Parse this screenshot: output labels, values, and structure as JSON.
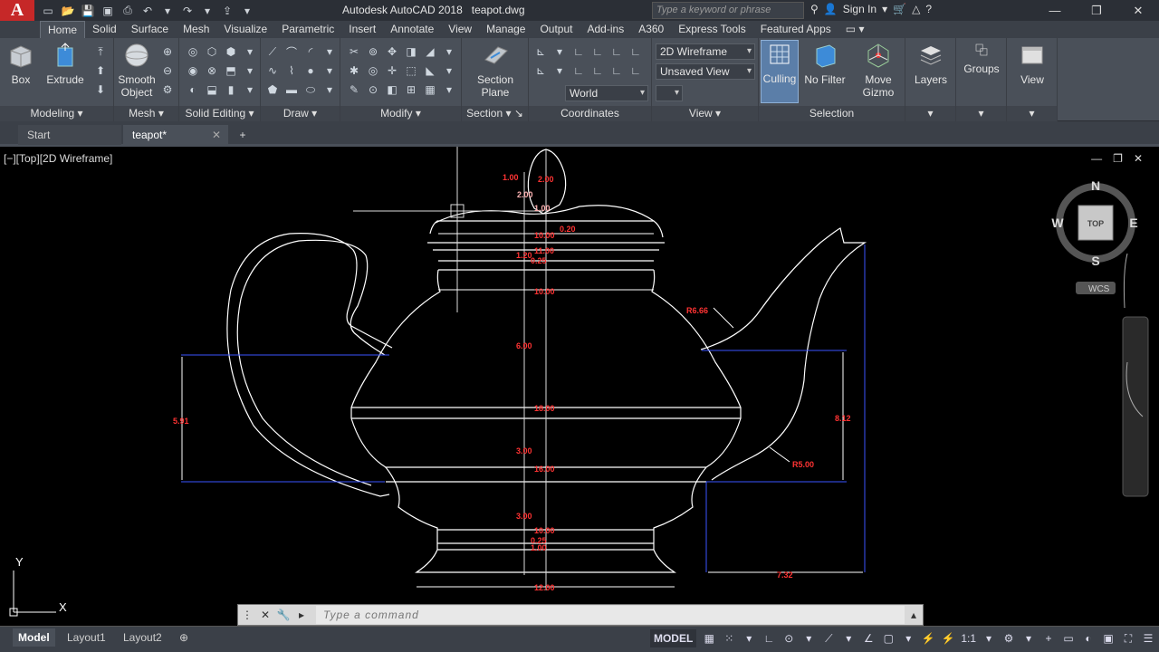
{
  "app": {
    "logo": "A",
    "title": "Autodesk AutoCAD 2018",
    "filename": "teapot.dwg",
    "search_placeholder": "Type a keyword or phrase",
    "signin": "Sign In"
  },
  "ribbon_tabs": [
    "Home",
    "Solid",
    "Surface",
    "Mesh",
    "Visualize",
    "Parametric",
    "Insert",
    "Annotate",
    "View",
    "Manage",
    "Output",
    "Add-ins",
    "A360",
    "Express Tools",
    "Featured Apps"
  ],
  "ribbon": {
    "modeling": {
      "title": "Modeling",
      "box": "Box",
      "extrude": "Extrude"
    },
    "mesh": {
      "title": "Mesh",
      "smooth": "Smooth",
      "object": "Object"
    },
    "solid_editing": {
      "title": "Solid Editing"
    },
    "draw": {
      "title": "Draw"
    },
    "modify": {
      "title": "Modify"
    },
    "section": {
      "title": "Section",
      "plane1": "Section",
      "plane2": "Plane"
    },
    "coordinates": {
      "title": "Coordinates",
      "world": "World"
    },
    "view": {
      "title": "View",
      "visual_style": "2D Wireframe",
      "saved_view": "Unsaved View"
    },
    "selection": {
      "title": "Selection",
      "culling": "Culling",
      "nofilter": "No Filter",
      "gizmo1": "Move",
      "gizmo2": "Gizmo"
    },
    "layers": "Layers",
    "groups": "Groups",
    "view_btn": "View"
  },
  "doc_tabs": {
    "start": "Start",
    "active": "teapot*"
  },
  "viewport": {
    "label": "[−][Top][2D Wireframe]",
    "viewcube": {
      "n": "N",
      "s": "S",
      "e": "E",
      "w": "W",
      "top": "TOP",
      "wcs": "WCS"
    },
    "axis_x": "X",
    "axis_y": "Y"
  },
  "dimensions": {
    "d1": "1.00",
    "d2": "2.00",
    "d3": "2.00",
    "d4": "1.00",
    "d5": "0.20",
    "d6": "10.00",
    "d7": "11.00",
    "d8": "1.20",
    "d9": "0.25",
    "d10": "10.00",
    "d11": "6.00",
    "d12": "18.00",
    "d13": "3.00",
    "d14": "16.00",
    "d15": "3.00",
    "d16": "10.00",
    "d17": "0.25",
    "d18": "1.00",
    "d19": "12.00",
    "d20": "5.91",
    "d21": "8.12",
    "d22": "7.32",
    "r1": "R6.66",
    "r2": "R5.00"
  },
  "command": {
    "placeholder": "Type a command"
  },
  "statusbar": {
    "model": "Model",
    "layout1": "Layout1",
    "layout2": "Layout2",
    "model_btn": "MODEL",
    "scale": "1:1"
  },
  "colors": {
    "dim_text": "#ff3333",
    "geometry": "#ffffff",
    "dim_lines": "#3a55ff",
    "ribbon": "#4a5059"
  }
}
